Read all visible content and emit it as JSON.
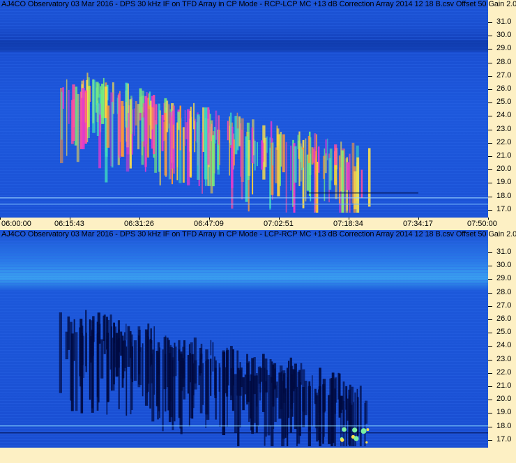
{
  "top_panel": {
    "title": "AJ4CO Observatory 03 Mar 2016 - DPS 30 kHz IF on TFD Array in CP Mode - RCP-LCP  MC +13 dB  Correction Array 2014 12 18 B.csv  Offset 50  Gain 2.0",
    "y_ticks": [
      "31.0",
      "30.0",
      "29.0",
      "28.0",
      "27.0",
      "26.0",
      "25.0",
      "24.0",
      "23.0",
      "22.0",
      "21.0",
      "20.0",
      "19.0",
      "18.0",
      "17.0"
    ],
    "x_ticks": [
      "06:00:00",
      "06:15:43",
      "06:31:26",
      "06:47:09",
      "07:02:51",
      "07:18:34",
      "07:34:17",
      "07:50:00"
    ]
  },
  "bottom_panel": {
    "title": "AJ4CO Observatory 03 Mar 2016 - DPS 30 kHz IF on TFD Array in CP Mode - LCP-RCP  MC +13 dB  Correction Array 2014 12 18 B.csv  Offset 50  Gain 2.0",
    "y_ticks": [
      "31.0",
      "30.0",
      "29.0",
      "28.0",
      "27.0",
      "26.0",
      "25.0",
      "24.0",
      "23.0",
      "22.0",
      "21.0",
      "20.0",
      "19.0",
      "18.0",
      "17.0"
    ]
  },
  "colors": {
    "background": "#1a4fd6",
    "axis_bg": "#fdf0c4"
  }
}
